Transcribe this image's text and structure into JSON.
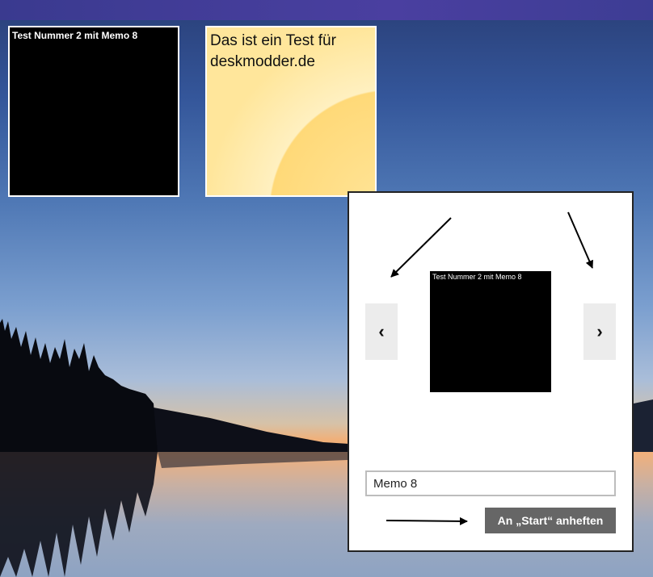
{
  "tiles": {
    "black": {
      "text": "Test Nummer 2 mit Memo 8"
    },
    "yellow": {
      "text": "Das ist ein Test für deskmodder.de"
    }
  },
  "flyout": {
    "prev_label": "‹",
    "next_label": "›",
    "preview_text": "Test Nummer 2 mit Memo 8",
    "name_value": "Memo 8",
    "pin_label": "An „Start“ anheften"
  },
  "colors": {
    "tile_black": "#000000",
    "tile_yellow": "#ffe08a",
    "pin_button": "#666666",
    "topbar": "#3f3f97"
  }
}
